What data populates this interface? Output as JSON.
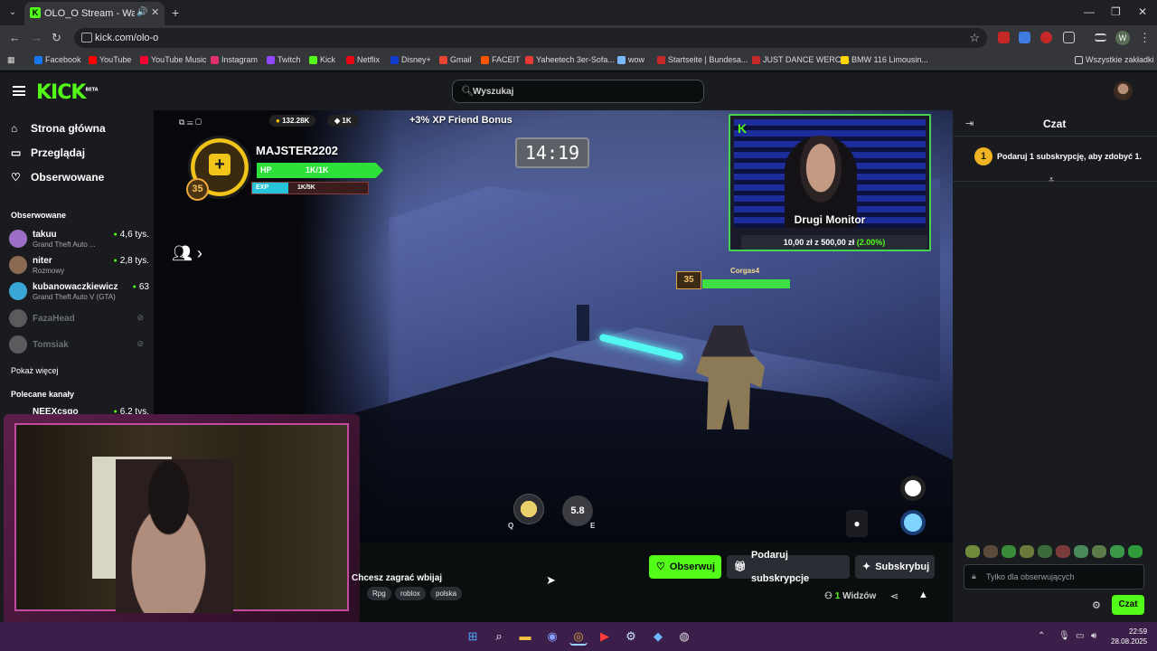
{
  "browser": {
    "tab_title": "OLO_O Stream - Watch Live",
    "url": "kick.com/olo-o",
    "bookmarks": [
      {
        "label": "Facebook",
        "color": "#1877f2"
      },
      {
        "label": "YouTube",
        "color": "#ff0000"
      },
      {
        "label": "YouTube Music",
        "color": "#ff0033"
      },
      {
        "label": "Instagram",
        "color": "#e1306c"
      },
      {
        "label": "Twitch",
        "color": "#9146ff"
      },
      {
        "label": "Kick",
        "color": "#53fc18"
      },
      {
        "label": "Netflix",
        "color": "#e50914"
      },
      {
        "label": "Disney+",
        "color": "#113ccf"
      },
      {
        "label": "Gmail",
        "color": "#ea4335"
      },
      {
        "label": "FACEIT",
        "color": "#ff5500"
      },
      {
        "label": "Yaheetech 3er-Sofa...",
        "color": "#e53935"
      },
      {
        "label": "wow",
        "color": "#7ab8ff"
      },
      {
        "label": "Startseite | Bundesa...",
        "color": "#c62828"
      },
      {
        "label": "JUST DANCE WERCI...",
        "color": "#c62828"
      },
      {
        "label": "BMW 116 Limousin...",
        "color": "#ffd600"
      }
    ],
    "all_bookmarks": "Wszystkie zakładki"
  },
  "header": {
    "logo": "KICK",
    "logo_beta": "BETA",
    "search_placeholder": "Wyszukaj"
  },
  "sidebar": {
    "nav": [
      "Strona główna",
      "Przeglądaj",
      "Obserwowane"
    ],
    "followed_title": "Obserwowane",
    "followed": [
      {
        "name": "takuu",
        "game": "Grand Theft Auto ...",
        "viewers": "4,6 tys.",
        "color": "#9b6fc6"
      },
      {
        "name": "niter",
        "game": "Rozmowy",
        "viewers": "2,8 tys.",
        "color": "#8b6a52"
      },
      {
        "name": "kubanowaczkiewicz",
        "game": "Grand Theft Auto V (GTA)",
        "viewers": "63",
        "color": "#3aa6d8"
      }
    ],
    "offline": [
      "FazaHead",
      "Tomsiak"
    ],
    "show_more": "Pokaż więcej",
    "recommended_title": "Polecane kanały",
    "recommended": [
      {
        "name": "NEEXcsgo",
        "viewers": "6,2 tys."
      }
    ]
  },
  "video": {
    "coins": "132.28K",
    "gems": "1K",
    "xp_bonus": "+3% XP Friend Bonus",
    "timer": "14:19",
    "player_name": "MAJSTER2202",
    "player_level": "35",
    "hp_label": "HP",
    "hp_value": "1K/1K",
    "exp_label": "EXP",
    "exp_value": "1K/5K",
    "enemy_name": "Corgas4",
    "enemy_level": "35",
    "ability_q": "Q",
    "ability_e": "E",
    "cooldown": "5.8",
    "cam_caption": "Drugi Monitor",
    "sub_goal": "10,00 zł z 500,00 zł",
    "sub_goal_pct": "(2.00%)"
  },
  "stream": {
    "title": "Chcesz zagrać wbijaj",
    "tags": [
      "Rpg",
      "roblox",
      "polska"
    ],
    "follow_label": "Obserwuj",
    "gift_label": "Podaruj subskrypcje",
    "subscribe_label": "Subskrybuj",
    "viewers_count": "1",
    "viewers_label": "Widzów"
  },
  "chat": {
    "title": "Czat",
    "gift_badge": "1",
    "gift_text": "Podaruj 1 subskrypcję, aby zdobyć 1.",
    "input_placeholder": "Tylko dla obserwujących",
    "send_label": "Czat"
  },
  "taskbar": {
    "time": "22:59",
    "date": "28.08.2025"
  }
}
